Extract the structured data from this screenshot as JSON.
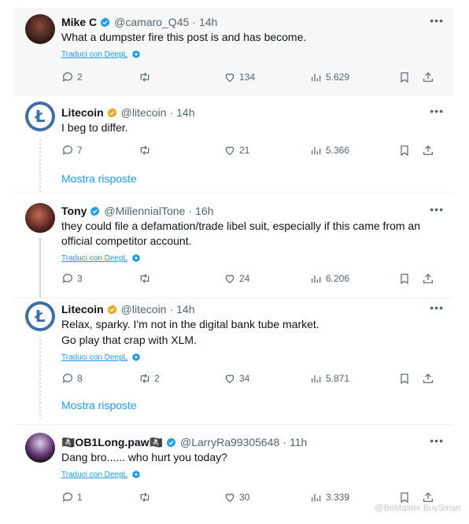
{
  "tweets": [
    {
      "name": "Mike C",
      "handle": "@camaro_Q45",
      "time": "14h",
      "text": "What a dumpster fire this post is and has become.",
      "translate": "Traduci con DeepL",
      "replies": "2",
      "retweets": "",
      "likes": "134",
      "views": "5.629",
      "verified": true,
      "verified_color": "#1d9bf0"
    },
    {
      "name": "Litecoin",
      "handle": "@litecoin",
      "time": "14h",
      "text": "I beg to differ.",
      "replies": "7",
      "retweets": "",
      "likes": "21",
      "views": "5.366",
      "verified": true,
      "verified_color": "#e8a81c",
      "more_replies": "Mostra risposte"
    },
    {
      "name": "Tony",
      "handle": "@MillennialTone",
      "time": "16h",
      "text": "they could file a defamation/trade libel suit, especially if this came from an official competitor account.",
      "translate": "Traduci con DeepL",
      "replies": "3",
      "retweets": "",
      "likes": "24",
      "views": "6.206",
      "verified": true,
      "verified_color": "#1d9bf0"
    },
    {
      "name": "Litecoin",
      "handle": "@litecoin",
      "time": "14h",
      "text_line1": "Relax, sparky. I'm not in the digital bank tube market.",
      "text_line2": "Go play that crap with XLM.",
      "translate": "Traduci con DeepL",
      "replies": "8",
      "retweets": "2",
      "likes": "34",
      "views": "5.871",
      "verified": true,
      "verified_color": "#e8a81c",
      "more_replies": "Mostra risposte"
    },
    {
      "name": "🏴‍☠️OB1Long.paw🏴‍☠️",
      "handle": "@LarryRa99305648",
      "time": "11h",
      "text": "Dang bro...... who hurt you today?",
      "translate": "Traduci con DeepL",
      "replies": "1",
      "retweets": "",
      "likes": "30",
      "views": "3.339",
      "verified": true,
      "verified_color": "#1d9bf0"
    }
  ],
  "separator": "·",
  "more_glyph": "•••",
  "litecoin_logo_letter": "Ł",
  "watermark": "@BeMaster BuySmart",
  "colors": {
    "link": "#1d9bf0",
    "muted": "#536471",
    "highlight_bg": "#f7f7f7",
    "ltc_blue": "#3b6fa8"
  }
}
